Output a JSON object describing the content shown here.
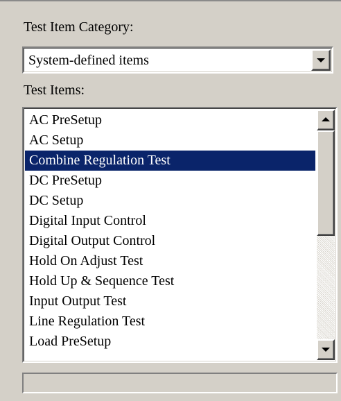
{
  "category": {
    "label": "Test Item Category:",
    "selected_value": "System-defined items"
  },
  "items": {
    "label": "Test Items:",
    "list": [
      {
        "label": "AC PreSetup",
        "selected": false
      },
      {
        "label": "AC Setup",
        "selected": false
      },
      {
        "label": "Combine Regulation Test",
        "selected": true
      },
      {
        "label": "DC PreSetup",
        "selected": false
      },
      {
        "label": "DC Setup",
        "selected": false
      },
      {
        "label": "Digital Input Control",
        "selected": false
      },
      {
        "label": "Digital Output Control",
        "selected": false
      },
      {
        "label": "Hold On Adjust Test",
        "selected": false
      },
      {
        "label": "Hold Up & Sequence Test",
        "selected": false
      },
      {
        "label": "Input Output Test",
        "selected": false
      },
      {
        "label": "Line Regulation Test",
        "selected": false
      },
      {
        "label": "Load PreSetup",
        "selected": false
      }
    ],
    "scroll_position": 0
  },
  "status_bar": {
    "text": ""
  },
  "colors": {
    "panel_bg": "#d4d0c8",
    "selection_bg": "#0a246a",
    "selection_fg": "#ffffff"
  },
  "icons": {
    "combo_dropdown": "chevron-down-icon",
    "scroll_up": "scroll-up-arrow-icon",
    "scroll_down": "scroll-down-arrow-icon"
  }
}
